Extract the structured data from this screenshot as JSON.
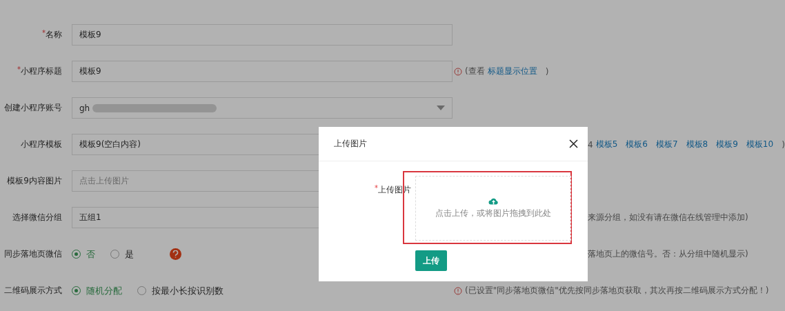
{
  "form": {
    "rows": [
      {
        "kind": "text",
        "required_mark": "*",
        "label": "名称",
        "value": "模板9"
      },
      {
        "kind": "text",
        "required_mark": "*",
        "label": "小程序标题",
        "value": "模板9",
        "note": {
          "kind": "info",
          "before": "(查看",
          "link": "标题显示位置",
          "after": ")"
        }
      },
      {
        "kind": "select",
        "label": "创建小程序账号",
        "value": "gh"
      },
      {
        "kind": "text",
        "label": "小程序模板",
        "value": "模板9(空白内容)",
        "note": {
          "kind": "links",
          "before": "4",
          "links": [
            "模板5",
            "模板6",
            "模板7",
            "模板8",
            "模板9",
            "模板10"
          ],
          "after": ")"
        }
      },
      {
        "kind": "text",
        "label": "模板9内容图片",
        "placeholder": "点击上传图片"
      },
      {
        "kind": "text",
        "label": "选择微信分组",
        "value": "五组1",
        "note": {
          "kind": "plain",
          "before": "来源分组，如没有请在微信在线管理中添加)"
        }
      },
      {
        "kind": "radio",
        "label": "同步落地页微信",
        "help": true,
        "options": [
          {
            "label": "否",
            "selected": true
          },
          {
            "label": "是",
            "selected": false
          }
        ],
        "note": {
          "kind": "plain",
          "before": "落地页上的微信号。否：从分组中随机显示)"
        }
      },
      {
        "kind": "radio",
        "label": "二维码展示方式",
        "options": [
          {
            "label": "随机分配",
            "selected": true
          },
          {
            "label": "按最小长按识别数",
            "selected": false
          }
        ],
        "note": {
          "kind": "info",
          "before": "(已设置\"同步落地页微信\"优先按同步落地页获取，其次再按二维码展示方式分配！)"
        }
      }
    ]
  },
  "dialog": {
    "title": "上传图片",
    "required_mark": "*",
    "field_label": "上传图片",
    "drop_hint": "点击上传，或将图片拖拽到此处",
    "highlighted": true,
    "submit": "上传"
  }
}
